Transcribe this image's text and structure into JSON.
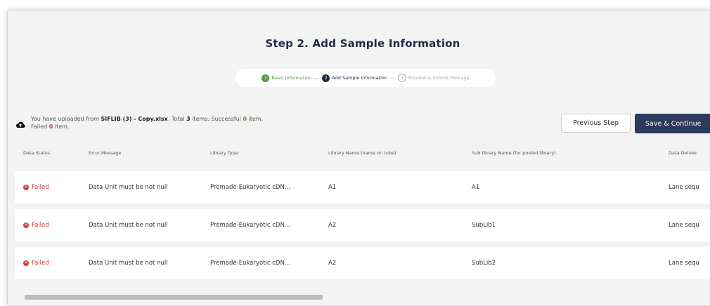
{
  "page": {
    "title": "Step 2. Add Sample Information"
  },
  "stepper": {
    "steps": [
      {
        "num": "1",
        "label": "Basic Information",
        "state": "done"
      },
      {
        "num": "2",
        "label": "Add Sample Information",
        "state": "active"
      },
      {
        "num": "3",
        "label": "Preview & Submit Package",
        "state": "todo"
      }
    ],
    "separator": "—"
  },
  "upload": {
    "prefix": "You have uploaded from ",
    "filename": "SIFLIB (3) - Copy.xlsx",
    "total_text": ". Total ",
    "total": "3",
    "items_text": " items. Successful ",
    "successful": "0",
    "item_suffix": " item.",
    "failed_prefix": "Failed ",
    "failed": "0",
    "failed_suffix": " item."
  },
  "actions": {
    "previous_label": "Previous Step",
    "save_label": "Save & Continue"
  },
  "table": {
    "columns": [
      "Data Status",
      "Error Message",
      "Library Type",
      "Library Name (name on tube)",
      "Sub library Name (for pooled library)",
      "Data Deliver"
    ],
    "rows": [
      {
        "status": "Failed",
        "error": "Data Unit must be not null",
        "library_type": "Premade-Eukaryotic cDN...",
        "library_name": "A1",
        "sub_library": "A1",
        "delivery": "Lane sequ"
      },
      {
        "status": "Failed",
        "error": "Data Unit must be not null",
        "library_type": "Premade-Eukaryotic cDN...",
        "library_name": "A2",
        "sub_library": "SubLib1",
        "delivery": "Lane sequ"
      },
      {
        "status": "Failed",
        "error": "Data Unit must be not null",
        "library_type": "Premade-Eukaryotic cDN...",
        "library_name": "A2",
        "sub_library": "SubLib2",
        "delivery": "Lane sequ"
      }
    ]
  },
  "colors": {
    "brand_dark": "#1f2a44",
    "success_green": "#5c9a3c",
    "error_red": "#d13a3a",
    "button_primary": "#2e3a5c"
  },
  "icons": {
    "upload": "cloud-upload-icon",
    "failed": "close-circle-icon"
  }
}
